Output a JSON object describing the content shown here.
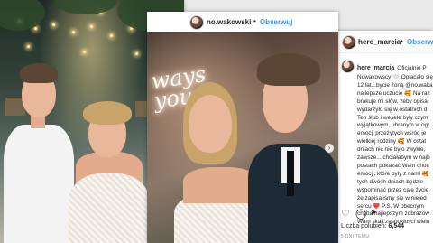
{
  "post_left": {},
  "post_middle": {
    "username": "no.wakowski",
    "follow_label": "Obserwuj",
    "separator": "•",
    "neon_sign": "ways\nyou"
  },
  "post_right": {
    "username": "here_marcia",
    "follow_label": "Obserwuj",
    "separator": "•",
    "caption_user": "here_marcia",
    "caption_lines": [
      "Oficjalnie P",
      "Nowakowscy 🤍 Opłacało się",
      "12 lat...byciе żoną @no.waka",
      "najlepsze uczucie 🥰 Na raz",
      "brakuje mi słów, żeby opisa",
      "wydarzyło się w ostatnich d",
      "Ten ślub i wesele były czym",
      "wyjątkowym, ubranym w ogr",
      "emocji przeżytych wśród je",
      "wielkiej rodziny 🥰 W ostat",
      "dniach nic nie było zwykłe,",
      "zawsze... chciałabym w najb",
      "postach pokazać Wam choć",
      "emocji, które były z nami 🥰",
      "tych dwóch dniach będzie",
      "wspominać przez całe życie",
      "że zapisaliśmy się w niejed",
      "sercu ❤️ P.S. W obecnym",
      "chyba najlepszym zobrazow",
      "Wam skali zaspokłości wielu"
    ],
    "likes_label": "Liczba polubień:",
    "likes_count": "6,544",
    "time_label": "5 DNI TEMU"
  }
}
